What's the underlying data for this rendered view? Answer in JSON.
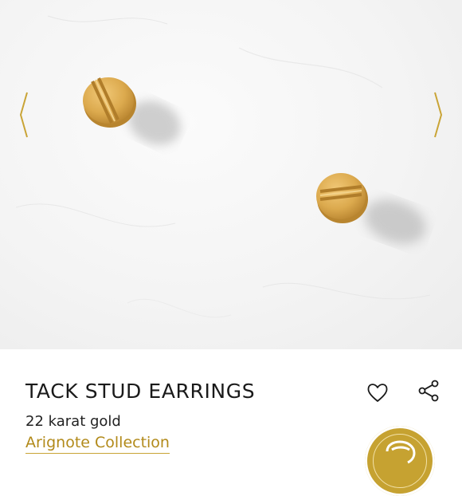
{
  "gallery": {
    "prev_icon": "chevron-left-icon",
    "next_icon": "chevron-right-icon",
    "arrow_color": "#c9a436",
    "background_color": "#f3f3f3"
  },
  "product": {
    "name": "TACK STUD EARRINGS",
    "material": "22 karat gold",
    "collection": "Arignote Collection"
  },
  "actions": {
    "favorite_icon": "heart-outline-icon",
    "share_icon": "share-icon",
    "chat_icon": "chat-bubble-icon"
  },
  "colors": {
    "accent": "#c9a436",
    "gold": "#d9aa4c",
    "text": "#1a1a1a"
  }
}
